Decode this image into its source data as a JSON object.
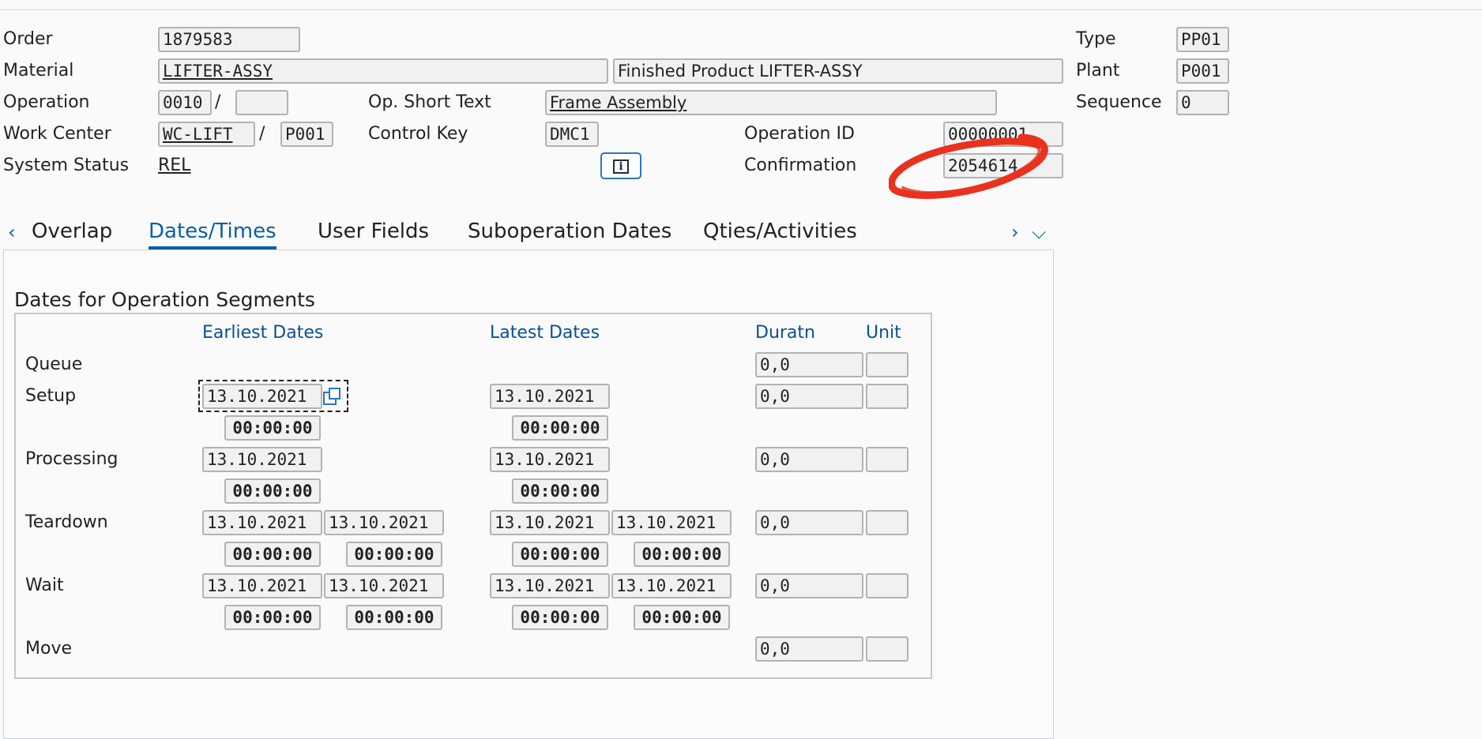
{
  "header": {
    "order_label": "Order",
    "order_value": "1879583",
    "material_label": "Material",
    "material_value": "LIFTER-ASSY",
    "material_desc": "Finished Product LIFTER-ASSY",
    "operation_label": "Operation",
    "operation_value": "0010",
    "operation_sub": "",
    "op_short_text_label": "Op. Short Text",
    "op_short_text_value": "Frame Assembly",
    "work_center_label": "Work Center",
    "work_center_value": "WC-LIFT",
    "work_center_plant": "P001",
    "control_key_label": "Control Key",
    "control_key_value": "DMC1",
    "operation_id_label": "Operation ID",
    "operation_id_value": "00000001",
    "system_status_label": "System Status",
    "system_status_value": "REL",
    "confirmation_label": "Confirmation",
    "confirmation_value": "2054614",
    "type_label": "Type",
    "type_value": "PP01",
    "plant_label": "Plant",
    "plant_value": "P001",
    "sequence_label": "Sequence",
    "sequence_value": "0",
    "separator": "/",
    "info_icon": "info-icon"
  },
  "tabs": {
    "prev_arrow": "‹",
    "next_arrow": "›",
    "more_arrow": "⌵",
    "items": [
      "Overlap",
      "Dates/Times",
      "User Fields",
      "Suboperation Dates",
      "Qties/Activities"
    ],
    "active": "Dates/Times"
  },
  "dates": {
    "group_title": "Dates for Operation Segments",
    "col_earliest": "Earliest Dates",
    "col_latest": "Latest Dates",
    "col_duration": "Duratn",
    "col_unit": "Unit",
    "date": "13.10.2021",
    "time": "00:00:00",
    "duration": "0,0",
    "unit": "",
    "rows": [
      "Queue",
      "Setup",
      "Processing",
      "Teardown",
      "Wait",
      "Move"
    ]
  },
  "annotation": {
    "color": "#e8321e"
  }
}
